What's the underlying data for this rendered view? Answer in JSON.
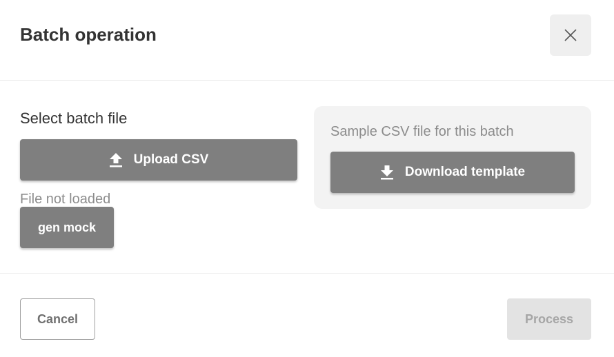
{
  "dialog": {
    "title": "Batch operation",
    "close_icon": "close-icon"
  },
  "upload_section": {
    "title": "Select batch file",
    "upload_label": "Upload CSV",
    "upload_icon": "upload-icon",
    "status": "File not loaded",
    "gen_mock_label": "gen mock"
  },
  "sample_section": {
    "label": "Sample CSV file for this batch",
    "download_label": "Download template",
    "download_icon": "download-icon"
  },
  "footer": {
    "cancel_label": "Cancel",
    "process_label": "Process",
    "process_disabled": true
  },
  "colors": {
    "primary_button": "#7f7f7f",
    "panel_background": "#f3f3f3",
    "disabled_button": "#e3e3e3",
    "title_text": "#333333",
    "muted_text": "#8c8c8c"
  }
}
